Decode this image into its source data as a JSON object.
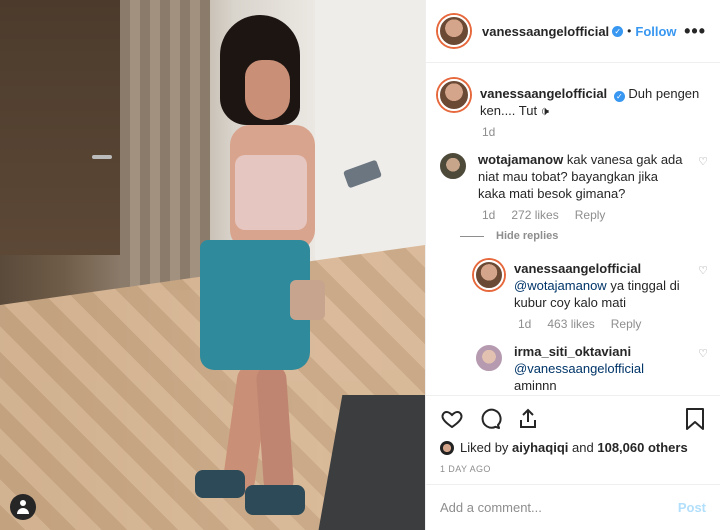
{
  "header": {
    "username": "vanessaangelofficial",
    "follow_label": "Follow",
    "separator": "•",
    "more": "•••"
  },
  "caption": {
    "username": "vanessaangelofficial",
    "text": "Duh pengen ken.... Tut 🕩",
    "time": "1d"
  },
  "comments": [
    {
      "username": "wotajamanow",
      "text": "kak vanesa gak ada niat mau tobat? bayangkan jika kaka mati besok gimana?",
      "time": "1d",
      "likes": "272 likes",
      "reply_label": "Reply",
      "hide_replies": "Hide replies"
    }
  ],
  "replies": [
    {
      "username": "vanessaangelofficial",
      "mention": "@wotajamanow",
      "text": "ya tinggal di kubur coy kalo mati",
      "time": "1d",
      "likes": "463 likes",
      "reply_label": "Reply"
    },
    {
      "username": "irma_siti_oktaviani",
      "mention": "@vanessaangelofficial",
      "text": "aminnn"
    }
  ],
  "likes": {
    "prefix": "Liked by",
    "user": "aiyhaqiqi",
    "and": "and",
    "count": "108,060 others"
  },
  "timestamp": "1 DAY AGO",
  "comment_box": {
    "placeholder": "Add a comment...",
    "post_label": "Post"
  },
  "colors": {
    "accent": "#3897f0",
    "link": "#003569",
    "muted": "#8e8e8e"
  }
}
